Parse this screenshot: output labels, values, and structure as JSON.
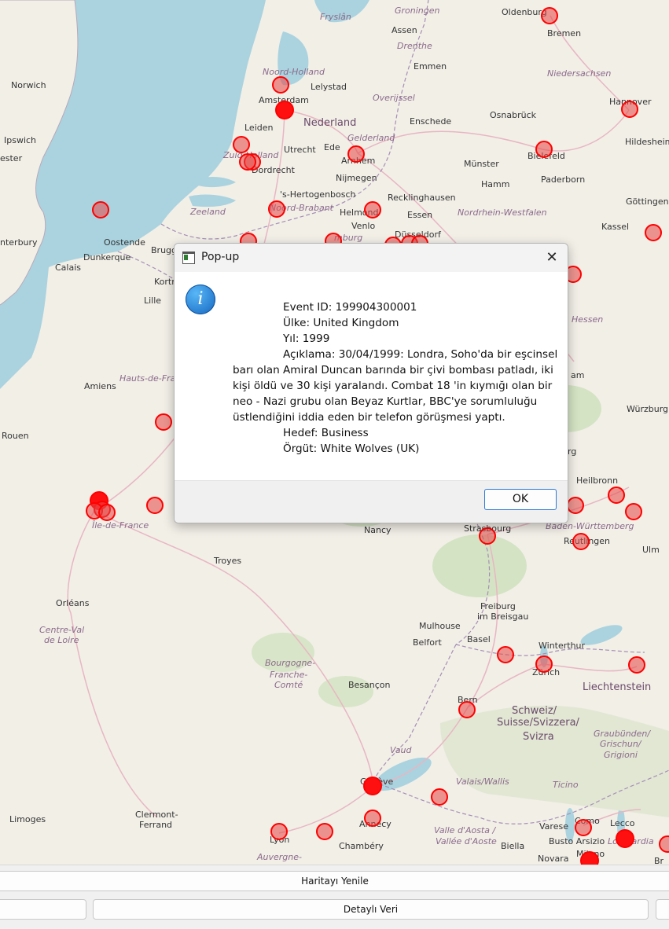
{
  "dialog": {
    "title": "Pop-up",
    "close_glyph": "✕",
    "icon": "information-icon",
    "lines": {
      "event_id": "Event ID: 199904300001",
      "country": "Ülke: United Kingdom",
      "year": "Yıl: 1999",
      "desc_1": "Açıklama: 30/04/1999: Londra, Soho'da bir eşcinsel",
      "desc_2": "barı olan Amiral Duncan barında bir çivi bombası patladı, iki",
      "desc_3": "kişi öldü ve 30 kişi yaralandı. Combat 18 'in kıymığı olan bir",
      "desc_4": "neo - Nazi grubu olan Beyaz Kurtlar, BBC'ye sorumluluğu",
      "desc_5": "üstlendiğini iddia eden bir telefon görüşmesi yaptı.",
      "target": "Hedef: Business",
      "org": "Örgüt: White Wolves (UK)"
    },
    "ok_label": "OK"
  },
  "panel": {
    "refresh_label": "Haritayı Yenile",
    "detail_label": "Detaylı Veri"
  },
  "map": {
    "colors": {
      "sea": "#aad3df",
      "land": "#f2efe7",
      "marker": "#ff0000"
    },
    "places": {
      "oldenburg": "Oldenburg",
      "bremen": "Bremen",
      "groningen": "Groningen",
      "frysian": "Fryslân",
      "assen": "Assen",
      "drenthe": "Drenthe",
      "emmen": "Emmen",
      "noord_holland": "Noord-Holland",
      "lelystad": "Lelystad",
      "amsterdam": "Amsterdam",
      "nederland": "Nederland",
      "overijssel": "Overijssel",
      "enschede": "Enschede",
      "niedersachsen": "Niedersachsen",
      "hannover": "Hannover",
      "osnabruck": "Osnabrück",
      "norwich": "Norwich",
      "ipswich": "Ipswich",
      "leiden": "Leiden",
      "utrecht": "Utrecht",
      "ede": "Ede",
      "gelderland": "Gelderland",
      "arnhem": "Arnhem",
      "bielefeld": "Bielefeld",
      "hildesheim": "Hildesheim",
      "zuid_holland": "Zuid-Holland",
      "dordrecht": "Dordrecht",
      "nijmegen": "Nijmegen",
      "munster": "Münster",
      "hamm": "Hamm",
      "paderborn": "Paderborn",
      "hertogenbosch": "'s-Hertogenbosch",
      "recklinghausen": "Recklinghausen",
      "zeeland": "Zeeland",
      "noord_brabant": "Noord-Brabant",
      "helmond": "Helmond",
      "essen": "Essen",
      "nrw": "Nordrhein-Westfalen",
      "gottingen": "Göttingen",
      "venlo": "Venlo",
      "kassel": "Kassel",
      "canterbury": "nterbury",
      "oostende": "Oostende",
      "brugge": "Brugg",
      "limburg": "mburg",
      "dusseldorf": "Düsseldorf",
      "dunkerque": "Dunkerque",
      "calais": "Calais",
      "kortrijk": "Kortr",
      "lille": "Lille",
      "hessen": "Hessen",
      "amiens": "Amiens",
      "hauts_de_france": "Hauts-de-France",
      "wurzburg": "Würzburg",
      "rouen": "Rouen",
      "heilbronn": "Heilbronn",
      "iledefrance": "Île-de-France",
      "nancy": "Nancy",
      "strasbourg": "Strasbourg",
      "bw": "Baden-Württemberg",
      "reutlingen": "Reutlingen",
      "ulm": "Ulm",
      "troyes": "Troyes",
      "orleans": "Orléans",
      "freiburg": "Freiburg",
      "breisgau": "im Breisgau",
      "mulhouse": "Mulhouse",
      "centre_val": "Centre-Val",
      "de_loire": "de Loire",
      "basel": "Basel",
      "winterthur": "Winterthur",
      "belfort": "Belfort",
      "zurich": "Zürich",
      "bourgogne": "Bourgogne-",
      "franche": "Franche-",
      "comte": "Comté",
      "besancon": "Besançon",
      "liechtenstein": "Liechtenstein",
      "bern": "Bern",
      "schweiz": "Schweiz/",
      "suisse": "Suisse/Svizzera/",
      "svizra": "Svizra",
      "graubunden": "Graubünden/",
      "grischun": "Grischun/",
      "grigioni": "Grigioni",
      "vaud": "Vaud",
      "valais": "Valais/Wallis",
      "ticino": "Ticino",
      "geneve": "Genève",
      "clermont": "Clermont-",
      "ferrand": "Ferrand",
      "limoges": "Limoges",
      "lyon": "Lyon",
      "annecy": "Annecy",
      "aosta_1": "Valle d'Aosta /",
      "aosta_2": "Vallée d'Aoste",
      "varese": "Varese",
      "lecco": "Lecco",
      "como": "Como",
      "busto": "Busto Arsizio",
      "biella": "Biella",
      "chambery": "Chambéry",
      "novara": "Novara",
      "milano": "Milano",
      "lombardia": "Lombardia",
      "auvergne": "Auvergne-",
      "ester": "ester",
      "am": "am",
      "rg": "rg",
      "br": "Br"
    }
  }
}
